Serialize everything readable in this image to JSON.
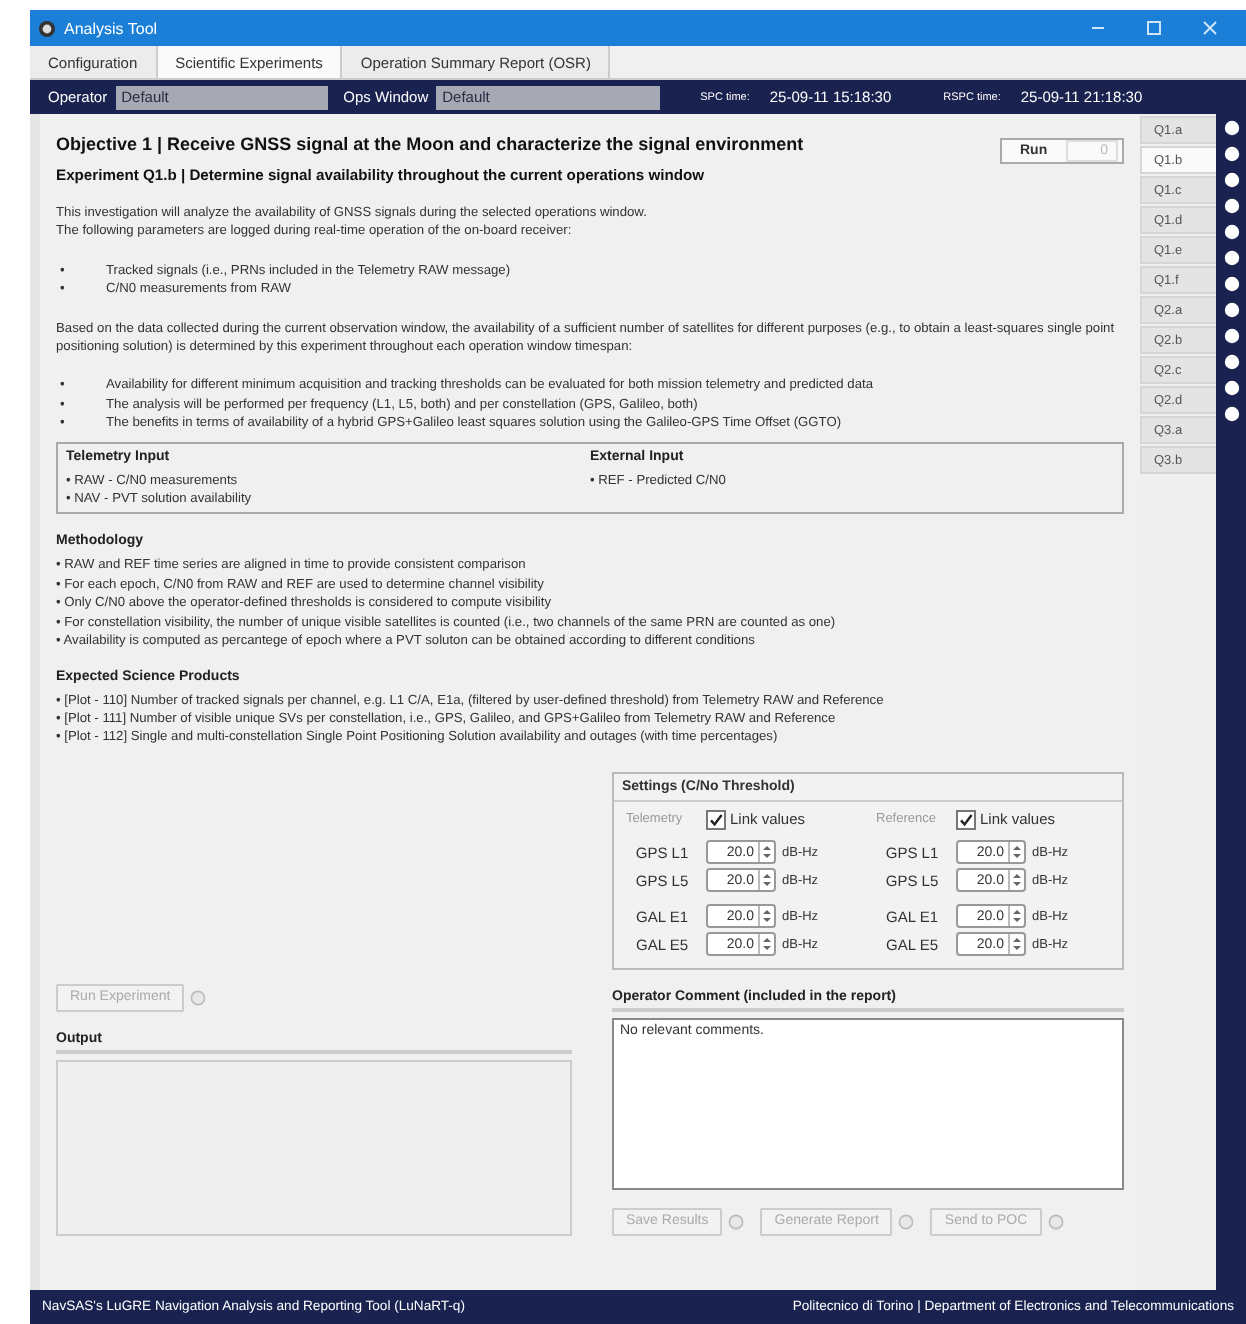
{
  "window": {
    "title": "Analysis Tool"
  },
  "tabs": [
    {
      "label": "Configuration",
      "selected": false
    },
    {
      "label": "Scientific Experiments",
      "selected": true
    },
    {
      "label": "Operation Summary Report (OSR)",
      "selected": false
    }
  ],
  "header": {
    "operator_label": "Operator",
    "operator_value": "Default",
    "ops_window_label": "Ops Window",
    "ops_window_value": "Default",
    "spc_label": "SPC time:",
    "spc_time": "25-09-11  15:18:30",
    "rspc_label": "RSPC time:",
    "rspc_time": "25-09-11  21:18:30"
  },
  "objective": "Objective 1 | Receive GNSS signal at the Moon and characterize the signal environment",
  "run": {
    "label": "Run",
    "count": "0"
  },
  "experiment_title": "Experiment Q1.b | Determine signal availability throughout the current operations window",
  "intro": [
    "This investigation will analyze the availability of GNSS signals during the selected operations window.",
    "The following parameters are logged during real-time operation of the on-board receiver:"
  ],
  "logged_params": [
    {
      "bullet": "•",
      "text": "Tracked signals (i.e., PRNs included in the Telemetry RAW message)"
    },
    {
      "bullet": "•",
      "text": "C/N0 measurements from RAW"
    }
  ],
  "basis": "Based on the data collected during the current observation window, the availability of a sufficient number of satellites for different purposes (e.g., to obtain a least-squares single point positioning solution) is determined by this experiment throughout each operation window timespan:",
  "goals": [
    {
      "bullet": "•",
      "text": "Availability for different minimum acquisition and tracking thresholds can be evaluated for both mission telemetry and predicted data"
    },
    {
      "bullet": "•",
      "text": "The analysis will be performed per frequency (L1, L5, both) and per constellation (GPS, Galileo, both)"
    },
    {
      "bullet": "•",
      "text": "The benefits in terms of availability of a hybrid GPS+Galileo least squares solution using the Galileo-GPS Time Offset (GGTO)"
    }
  ],
  "inputs": [
    {
      "title": "Telemetry Input",
      "items": [
        "• RAW - C/N0 measurements",
        "• NAV - PVT solution availability"
      ]
    },
    {
      "title": "External Input",
      "items": [
        "• REF - Predicted C/N0"
      ]
    }
  ],
  "sections": [
    {
      "title": "Methodology",
      "items": [
        "• RAW and REF time series are aligned in time to provide consistent comparison",
        "• For each epoch, C/N0 from RAW and REF are used to determine channel visibility",
        "• Only C/N0 above the operator-defined thresholds is considered to compute visibility",
        "• For constellation visibility, the number of unique visible satellites is counted (i.e., two channels of the same PRN are counted as one)",
        "• Availability is computed as percantege of epoch where a PVT soluton can be obtained according to different conditions"
      ]
    },
    {
      "title": "Expected Science Products",
      "items": [
        "• [Plot - 110] Number of tracked signals per channel, e.g. L1 C/A, E1a, (filtered by user-defined threshold) from Telemetry RAW and Reference",
        "• [Plot - 111] Number of visible unique SVs per constellation, i.e., GPS, Galileo, and GPS+Galileo from Telemetry RAW and Reference",
        "• [Plot - 112] Single and multi-constellation Single Point Positioning Solution availability and outages (with time percentages)"
      ]
    }
  ],
  "settings": {
    "title": "Settings (C/No Threshold)",
    "groups": [
      {
        "label": "Telemetry",
        "link_label": "Link values",
        "checked": true,
        "bands": [
          [
            {
              "label": "GPS L1",
              "value": "20.0",
              "unit": "dB-Hz"
            },
            {
              "label": "GPS L5",
              "value": "20.0",
              "unit": "dB-Hz"
            }
          ],
          [
            {
              "label": "GAL E1",
              "value": "20.0",
              "unit": "dB-Hz"
            },
            {
              "label": "GAL E5",
              "value": "20.0",
              "unit": "dB-Hz"
            }
          ]
        ]
      },
      {
        "label": "Reference",
        "link_label": "Link values",
        "checked": true,
        "bands": [
          [
            {
              "label": "GPS L1",
              "value": "20.0",
              "unit": "dB-Hz"
            },
            {
              "label": "GPS L5",
              "value": "20.0",
              "unit": "dB-Hz"
            }
          ],
          [
            {
              "label": "GAL E1",
              "value": "20.0",
              "unit": "dB-Hz"
            },
            {
              "label": "GAL E5",
              "value": "20.0",
              "unit": "dB-Hz"
            }
          ]
        ]
      }
    ]
  },
  "run_experiment": {
    "label": "Run Experiment",
    "disabled": true
  },
  "output": {
    "title": "Output"
  },
  "comment": {
    "title": "Operator Comment (included in the report)",
    "value": "No relevant comments."
  },
  "actions": [
    {
      "label": "Save Results",
      "disabled": true
    },
    {
      "label": "Generate Report",
      "disabled": true
    },
    {
      "label": "Send to POC",
      "disabled": true
    }
  ],
  "experiments": [
    {
      "label": "Q1.a",
      "selected": false
    },
    {
      "label": "Q1.b",
      "selected": true
    },
    {
      "label": "Q1.c",
      "selected": false
    },
    {
      "label": "Q1.d",
      "selected": false
    },
    {
      "label": "Q1.e",
      "selected": false
    },
    {
      "label": "Q1.f",
      "selected": false
    },
    {
      "label": "Q2.a",
      "selected": false
    },
    {
      "label": "Q2.b",
      "selected": false
    },
    {
      "label": "Q2.c",
      "selected": false
    },
    {
      "label": "Q2.d",
      "selected": false
    },
    {
      "label": "Q3.a",
      "selected": false
    },
    {
      "label": "Q3.b",
      "selected": false
    }
  ],
  "status_bar": {
    "left": "NavSAS's LuGRE Navigation Analysis and Reporting Tool (LuNaRT-q)",
    "right": "Politecnico di Torino | Department of Electronics and Telecommunications"
  }
}
